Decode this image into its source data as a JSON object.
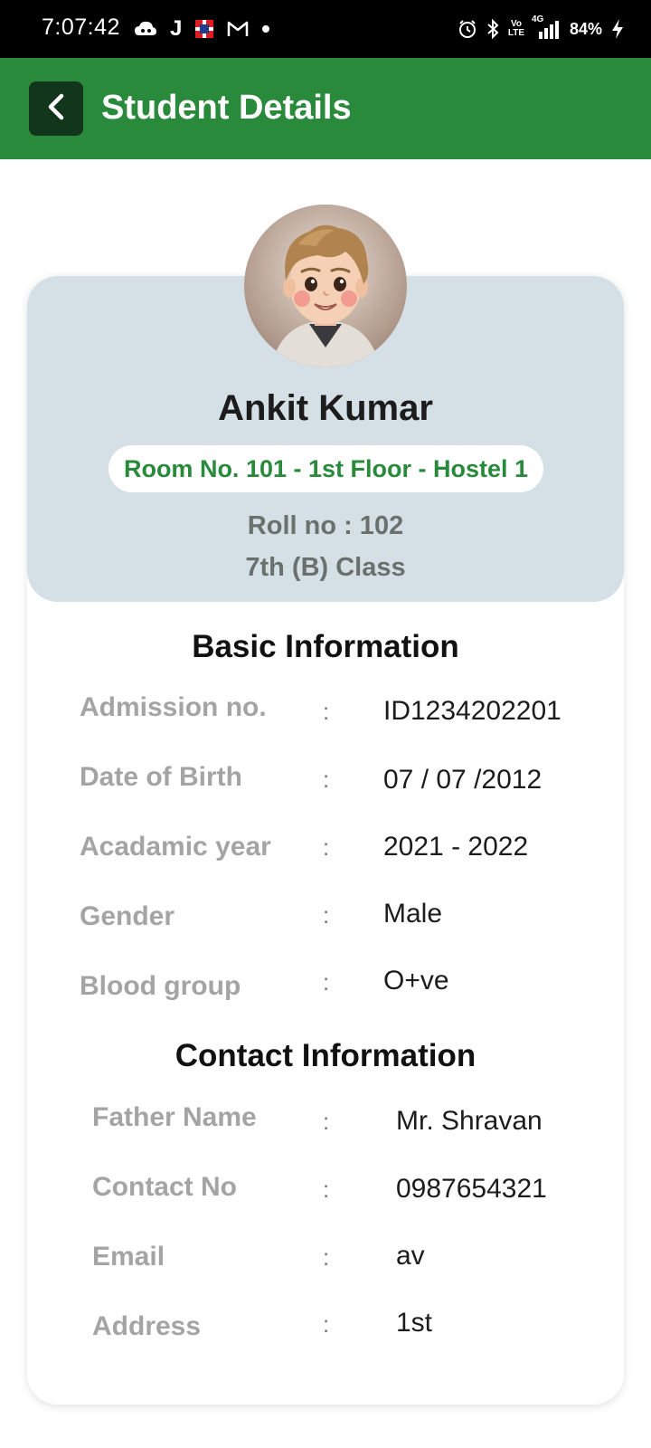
{
  "status_bar": {
    "time": "7:07:42",
    "left_icons": [
      "cloud-game-icon",
      "j-app-icon",
      "bank-app-icon",
      "gmail-icon",
      "dot-icon"
    ],
    "right_icons": [
      "alarm-icon",
      "bluetooth-icon",
      "volte-icon",
      "signal-4g-icon",
      "charging-icon"
    ],
    "volte_label": "Vo LTE",
    "network_label": "4G",
    "battery": "84%"
  },
  "app_bar": {
    "title": "Student Details",
    "back_icon": "chevron-left-icon",
    "color": "#2a8a3c"
  },
  "student": {
    "name": "Ankit Kumar",
    "room": "Room No. 101 - 1st Floor - Hostel 1",
    "roll": "Roll no : 102",
    "class": "7th (B) Class"
  },
  "basic_info": {
    "title": "Basic Information",
    "rows": [
      {
        "label": "Admission no.",
        "sep": ":",
        "value": "ID1234202201"
      },
      {
        "label": "Date of Birth",
        "sep": ":",
        "value": "07 / 07 /2012"
      },
      {
        "label": "Acadamic year",
        "sep": ":",
        "value": "2021 - 2022"
      },
      {
        "label": "Gender",
        "sep": ":",
        "value": "Male"
      },
      {
        "label": "Blood group",
        "sep": ":",
        "value": "O+ve"
      }
    ]
  },
  "contact_info": {
    "title": "Contact Information",
    "rows": [
      {
        "label": "Father Name",
        "sep": ":",
        "value": "Mr. Shravan"
      },
      {
        "label": "Contact No",
        "sep": ":",
        "value": "0987654321"
      },
      {
        "label": "Email",
        "sep": ":",
        "value": "av"
      },
      {
        "label": "Address",
        "sep": ":",
        "value": "1st"
      }
    ]
  }
}
